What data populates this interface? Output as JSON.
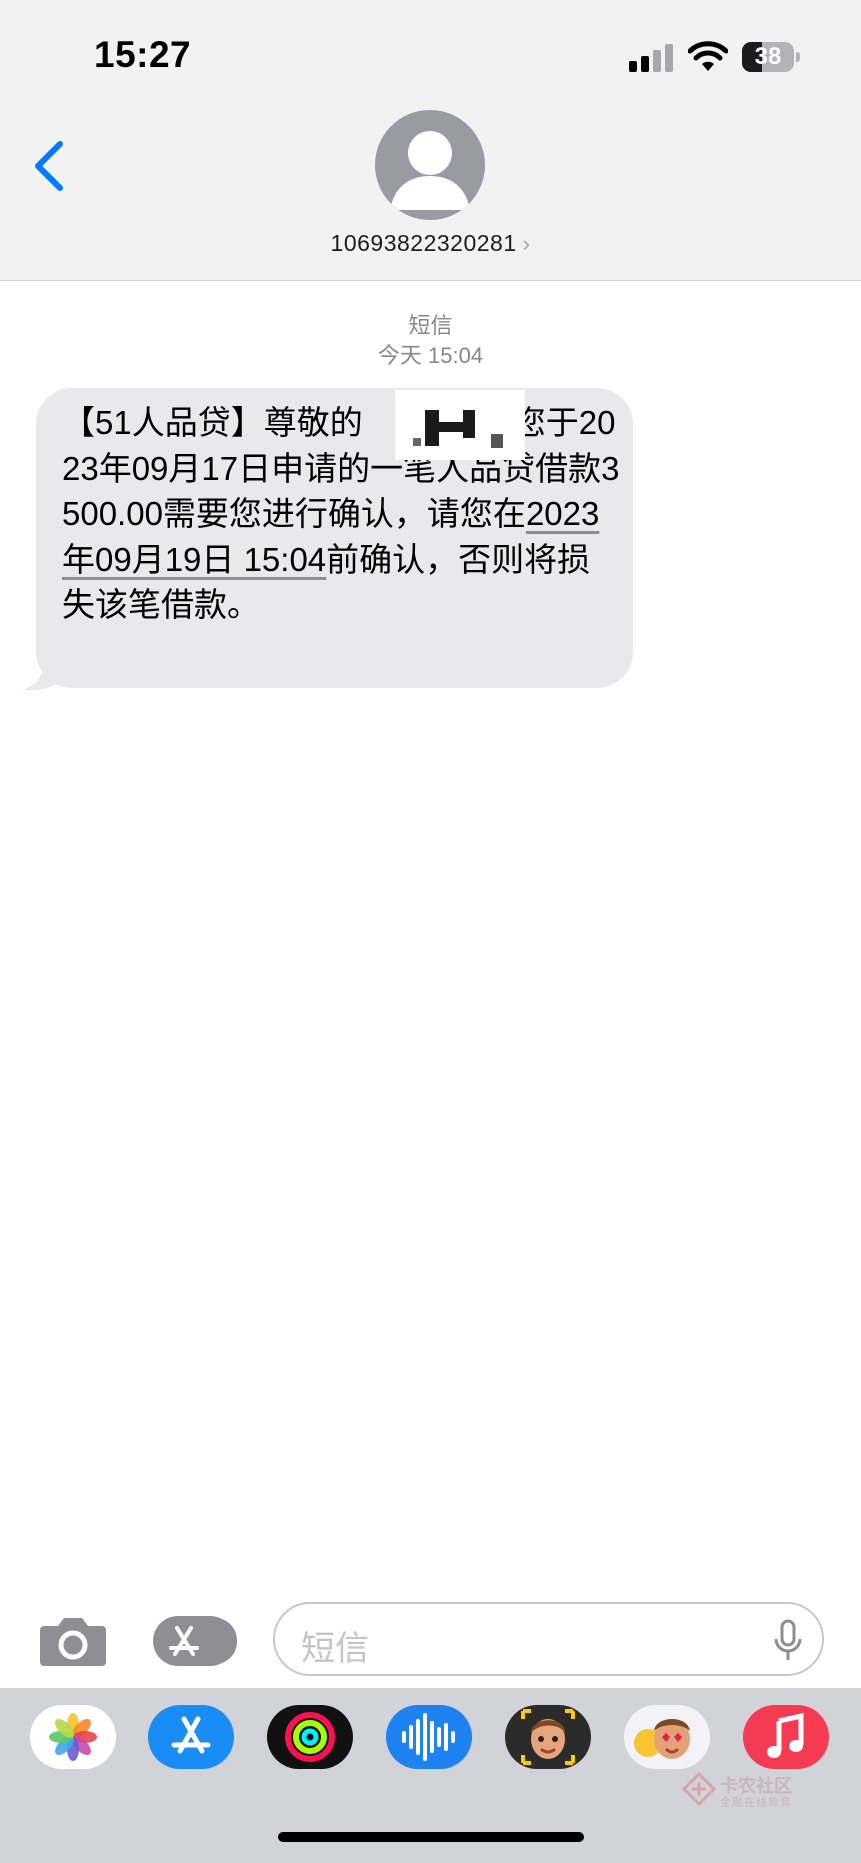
{
  "status_bar": {
    "time": "15:27",
    "battery": "38",
    "battery_fraction": 0.38
  },
  "header": {
    "contact_number": "10693822320281",
    "chevron": "›"
  },
  "conversation": {
    "channel_label": "短信",
    "timestamp": "今天 15:04",
    "message": {
      "part1": "【51人品贷】尊敬的",
      "part2": "您于2023年09月17日申请的一笔人品贷借款3500.00需要您进行确认，请您在",
      "link_date": "2023年09月19日 15:04",
      "part3": "前确认，否则将损失该笔借款。"
    }
  },
  "input_bar": {
    "placeholder": "短信"
  },
  "dock": {
    "apps": [
      "photos-icon",
      "app-store-icon",
      "fitness-icon",
      "voice-memos-icon",
      "memoji-icon",
      "memoji-stickers-icon",
      "music-icon"
    ]
  },
  "watermark": {
    "title": "卡农社区",
    "subtitle": "金融在线教育"
  },
  "colors": {
    "accent": "#007aff",
    "bubble": "#e9e9eb",
    "header_bg": "#f2f2f2",
    "dock_bg": "#d1d3d9"
  }
}
